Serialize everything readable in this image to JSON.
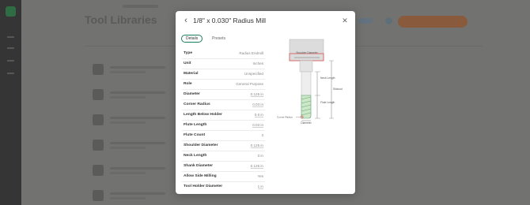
{
  "modal": {
    "title": "1/8\" x 0.030\" Radius Mill",
    "back_icon": "chevron-left-icon",
    "close_icon": "close-icon",
    "tabs": [
      {
        "label": "Details",
        "active": true
      },
      {
        "label": "Presets",
        "active": false
      }
    ],
    "properties": [
      {
        "label": "Type",
        "value": "Radius Endmill",
        "editable": false
      },
      {
        "label": "Unit",
        "value": "Inches",
        "editable": false
      },
      {
        "label": "Material",
        "value": "Unspecified",
        "editable": false
      },
      {
        "label": "Role",
        "value": "General Purpose",
        "editable": false
      },
      {
        "label": "Diameter",
        "value": "0.125 in",
        "editable": true
      },
      {
        "label": "Corner Radius",
        "value": "0.03 in",
        "editable": true
      },
      {
        "label": "Length Below Holder",
        "value": "0.6 in",
        "editable": true
      },
      {
        "label": "Flute Length",
        "value": "0.03 in",
        "editable": true
      },
      {
        "label": "Flute Count",
        "value": "3",
        "editable": false
      },
      {
        "label": "Shoulder Diameter",
        "value": "0.125 in",
        "editable": true
      },
      {
        "label": "Neck Length",
        "value": "0 in",
        "editable": false
      },
      {
        "label": "Shank Diameter",
        "value": "0.125 in",
        "editable": true
      },
      {
        "label": "Allow Side Milling",
        "value": "Yes",
        "editable": false
      },
      {
        "label": "Tool Holder Diameter",
        "value": "1 in",
        "editable": true
      }
    ],
    "diagram": {
      "labels": {
        "shoulder_diameter": "Shoulder Diameter",
        "neck_length": "Neck Length",
        "flute_length": "Flute Length",
        "stickout": "Stickout",
        "corner_radius": "Corner Radius",
        "diameter": "Diameter"
      },
      "colors": {
        "holder": "#dcdcdc",
        "holder_stroke": "#b8b8b8",
        "highlight": "#d9534f",
        "flute_fill": "#cde8c8",
        "flute_stroke": "#5fa070",
        "dim_line": "#555555"
      }
    }
  },
  "background": {
    "page_title": "Tool Libraries",
    "accent": "#e8643a"
  }
}
